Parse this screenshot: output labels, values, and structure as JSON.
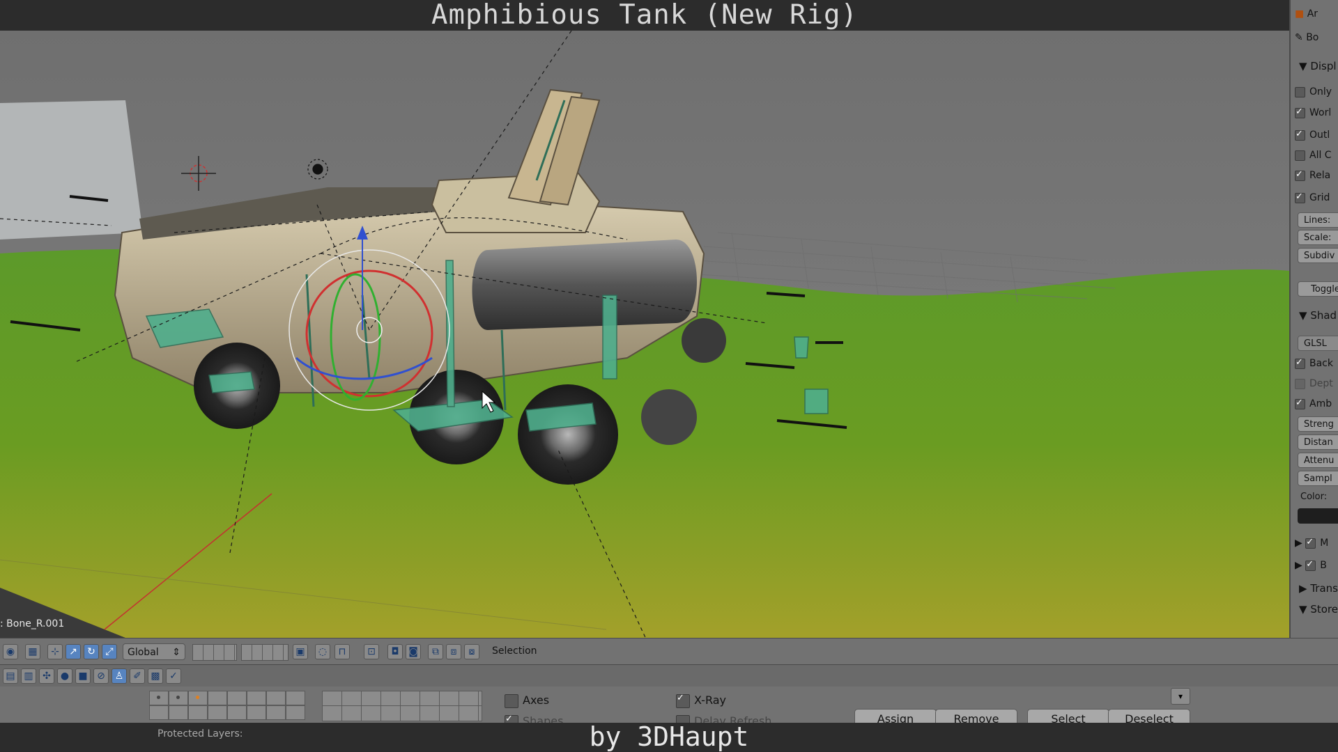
{
  "video": {
    "title": "Amphibious Tank (New Rig)",
    "credit": "by 3DHaupt"
  },
  "viewport": {
    "active_bone": ": Bone_R.001"
  },
  "properties_panel": {
    "display_header": "Displ",
    "checks": [
      {
        "label": "Only",
        "checked": false
      },
      {
        "label": "Worl",
        "checked": true
      },
      {
        "label": "Outl",
        "checked": true
      },
      {
        "label": "All C",
        "checked": false
      },
      {
        "label": "Rela",
        "checked": true
      },
      {
        "label": "Grid",
        "checked": true
      }
    ],
    "fields": [
      "Lines:",
      "Scale:",
      "Subdiv"
    ],
    "toggle_label": "Toggle",
    "shading_header": "Shad",
    "glsl_label": "GLSL",
    "shading_checks": [
      {
        "label": "Back",
        "checked": true
      },
      {
        "label": "Dept",
        "checked": false
      },
      {
        "label": "Amb",
        "checked": true
      }
    ],
    "ao_fields": [
      "Streng",
      "Distan",
      "Attenu",
      "Sampl"
    ],
    "color_label": "Color:",
    "sub_panels": [
      {
        "label": "M",
        "checked": true
      },
      {
        "label": "B",
        "checked": true
      }
    ],
    "transform_header": "Trans",
    "store_header": "Store",
    "top_labels": [
      "Ar",
      "Bo"
    ]
  },
  "header": {
    "orientation": "Global",
    "mode_label": "Selection"
  },
  "bone_props": {
    "axes_label": "Axes",
    "axes_checked": false,
    "shapes_label": "Shapes",
    "shapes_checked": true,
    "xray_label": "X-Ray",
    "xray_checked": true,
    "delay_label": "Delay Refresh",
    "delay_checked": false,
    "protected_label": "Protected Layers:",
    "buttons": {
      "assign": "Assign",
      "remove": "Remove",
      "select": "Select",
      "deselect": "Deselect"
    }
  }
}
